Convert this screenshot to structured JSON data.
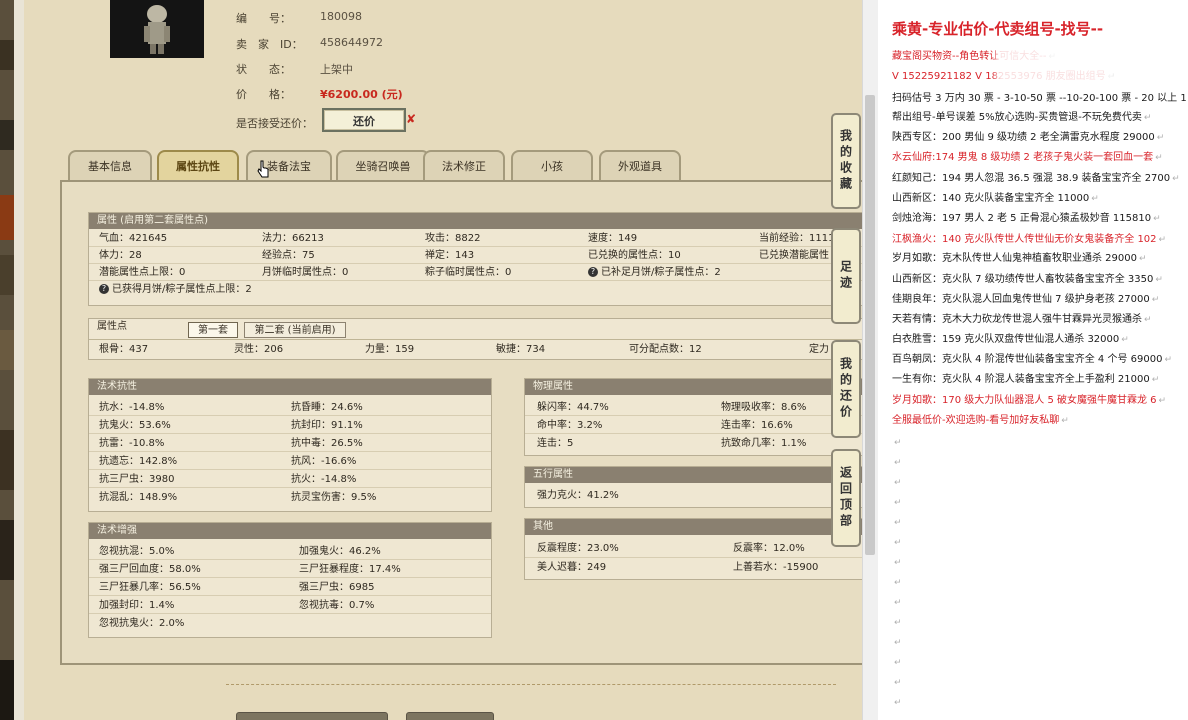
{
  "item": {
    "id_label": "编　　号：",
    "id_value": "180098",
    "seller_label": "卖　家　ID：",
    "seller_value": "458644972",
    "status_label": "状　　态：",
    "status_value": "上架中",
    "price_label": "价　　格：",
    "price_value": "¥6200.00 (元)",
    "counter_label": "是否接受还价：",
    "counter_button": "还价",
    "counter_mark": "✘"
  },
  "tabs": [
    "基本信息",
    "属性抗性",
    "装备法宝",
    "坐骑召唤兽",
    "法术修正",
    "小孩",
    "外观道具"
  ],
  "active_tab": 1,
  "attributes": {
    "header": "属性 (启用第二套属性点)",
    "row1": [
      "气血：421645",
      "法力：66213",
      "攻击：8822",
      "速度：149",
      "当前经验：1111"
    ],
    "row2": [
      "体力：28",
      "经验点：75",
      "禅定：143",
      "已兑换的属性点：10",
      "已兑换潜能属性"
    ],
    "row3": [
      "潜能属性点上限：0",
      "月饼临时属性点：0",
      "粽子临时属性点：0",
      "已补足月饼/粽子属性点：2"
    ],
    "row4": "已获得月饼/粽子属性点上限：2"
  },
  "attr_points": {
    "header": "属性点",
    "subtab1": "第一套",
    "subtab2": "第二套 (当前启用)",
    "values": [
      "根骨：437",
      "灵性：206",
      "力量：159",
      "敏捷：734",
      "可分配点数：12",
      "定力"
    ]
  },
  "resist": {
    "header": "法术抗性",
    "left": [
      "抗水：-14.8%",
      "抗鬼火：53.6%",
      "抗雷：-10.8%",
      "抗遗忘：142.8%",
      "抗三尸虫：3980",
      "抗混乱：148.9%"
    ],
    "right": [
      "抗昏睡：24.6%",
      "抗封印：91.1%",
      "抗中毒：26.5%",
      "抗风：-16.6%",
      "抗火：-14.8%",
      "抗灵宝伤害：9.5%"
    ]
  },
  "enhance": {
    "header": "法术增强",
    "left": [
      "忽视抗混：5.0%",
      "强三尸回血度：58.0%",
      "三尸狂暴几率：56.5%",
      "加强封印：1.4%",
      "忽视抗鬼火：2.0%"
    ],
    "right": [
      "加强鬼火：46.2%",
      "三尸狂暴程度：17.4%",
      "强三尸虫：6985",
      "忽视抗毒：0.7%"
    ]
  },
  "physical": {
    "header": "物理属性",
    "left": [
      "躲闪率：44.7%",
      "命中率：3.2%",
      "连击：5"
    ],
    "right": [
      "物理吸收率：8.6%",
      "连击率：16.6%",
      "抗致命几率：1.1%"
    ]
  },
  "five": {
    "header": "五行属性",
    "left": [
      "强力克火：41.2%"
    ]
  },
  "other": {
    "header": "其他",
    "left": [
      "反震程度：23.0%",
      "美人迟暮：249"
    ],
    "right": [
      "反震率：12.0%",
      "上善若水：-15900"
    ]
  },
  "side_buttons": [
    "我的收藏",
    "足迹",
    "我的还价",
    "返回顶部"
  ],
  "notes": {
    "title": "乘黄-专业估价-代卖组号-找号--",
    "lines": [
      {
        "text": "藏宝阁买物资--角色转让可信大全--",
        "color": "red"
      },
      {
        "text": "V 15225921182  V 182553976 朋友圈出组号",
        "color": "red"
      },
      {
        "text": "扫码估号 3 万内 30 票 - 3-10-50 票  --10-20-100 票 - 20 以上 1",
        "color": "black"
      },
      {
        "text": "帮出组号-单号误差 5%放心选购-买贵管退-不玩免费代卖",
        "color": "black"
      },
      {
        "text": "陕西专区：200 男仙 9 级功绩 2 老全满雷克水程度 29000",
        "color": "black"
      },
      {
        "text": "水云仙府:174 男鬼 8 级功绩 2 老孩子鬼火装一套回血一套",
        "color": "red"
      },
      {
        "text": "红颜知己：194 男人忽混 36.5 强混 38.9 装备宝宝齐全 2700",
        "color": "black"
      },
      {
        "text": "山西新区：140 克火队装备宝宝齐全 11000",
        "color": "black"
      },
      {
        "text": "剑烛沧海：197 男人 2 老 5 正骨混心猿孟极妙音 115810",
        "color": "black"
      },
      {
        "text": "江枫渔火：140 克火队传世人传世仙无价女鬼装备齐全 102",
        "color": "red"
      },
      {
        "text": "岁月如歌：克木队传世人仙鬼神植畜牧职业通杀 29000",
        "color": "black"
      },
      {
        "text": "山西新区：克火队 7 级功绩传世人畜牧装备宝宝齐全 3350",
        "color": "black"
      },
      {
        "text": "佳期良年：克火队混人回血鬼传世仙 7 级护身老孩 27000",
        "color": "black"
      },
      {
        "text": "天若有情：克木大力砍龙传世混人强牛甘霖异光灵猴通杀",
        "color": "black"
      },
      {
        "text": "白衣胜雪：159 克火队双盘传世仙混人通杀 32000",
        "color": "black"
      },
      {
        "text": "百鸟朝凤：克火队 4 阶混传世仙装备宝宝齐全 4 个号 69000",
        "color": "black"
      },
      {
        "text": "一生有你：克火队 4 阶混人装备宝宝齐全上手盈利 21000",
        "color": "black"
      },
      {
        "text": "岁月如歌：170 级大力队仙器混人 5 破女魔强牛魔甘霖龙 6",
        "color": "red"
      },
      {
        "text": "全服最低价-欢迎选购-看号加好友私聊",
        "color": "red"
      }
    ]
  }
}
